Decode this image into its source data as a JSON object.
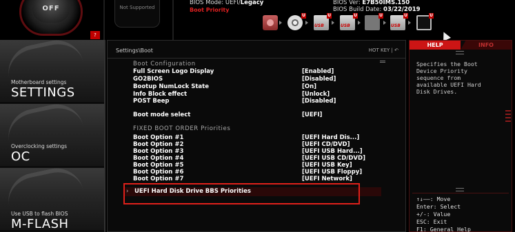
{
  "top": {
    "power_label": "OFF",
    "not_supported": "Not Supported",
    "bios_mode_prefix": "BIOS Mode: UEFI/",
    "bios_mode_value": "Legacy",
    "boot_priority": "Boot Priority",
    "bios_ver_prefix": "BIOS Ver: ",
    "bios_ver_value": "E7B50IMS.150",
    "bios_date_prefix": "BIOS Build Date: ",
    "bios_date_value": "03/22/2019",
    "badge": "?",
    "boot_devices": [
      {
        "icon": "hdd-icon"
      },
      {
        "icon": "cd-icon",
        "tag": "U"
      },
      {
        "icon": "usb-drive-icon",
        "label": "USB",
        "tag": "U"
      },
      {
        "icon": "usb-drive-icon",
        "label": "USB",
        "tag": "U"
      },
      {
        "icon": "usb-board-icon",
        "tag": "U"
      },
      {
        "icon": "usb-drive-icon",
        "label": "USB",
        "tag": "U"
      },
      {
        "icon": "network-icon",
        "tag": "U"
      }
    ]
  },
  "sidebar": {
    "items": [
      {
        "small": "Motherboard settings",
        "big": "SETTINGS"
      },
      {
        "small": "Overclocking settings",
        "big": "OC"
      },
      {
        "small": "Use USB to flash BIOS",
        "big": "M-FLASH"
      }
    ]
  },
  "main": {
    "breadcrumb": "Settings\\Boot",
    "hotkey": "HOT KEY  |  ↶",
    "boot_config_header": "Boot  Configuration",
    "config_rows": [
      {
        "label": "Full Screen Logo Display",
        "value": "[Enabled]"
      },
      {
        "label": "GO2BIOS",
        "value": "[Disabled]"
      },
      {
        "label": "Bootup NumLock State",
        "value": "[On]"
      },
      {
        "label": "Info Block effect",
        "value": "[Unlock]"
      },
      {
        "label": "POST Beep",
        "value": "[Disabled]"
      }
    ],
    "boot_mode": {
      "label": "Boot mode select",
      "value": "[UEFI]"
    },
    "fixed_header": "FIXED  BOOT  ORDER  Priorities",
    "boot_options": [
      {
        "label": "Boot Option #1",
        "value": "[UEFI Hard Dis...]"
      },
      {
        "label": "Boot Option #2",
        "value": "[UEFI CD/DVD]"
      },
      {
        "label": "Boot Option #3",
        "value": "[UEFI USB Hard...]"
      },
      {
        "label": "Boot Option #4",
        "value": "[UEFI USB CD/DVD]"
      },
      {
        "label": "Boot Option #5",
        "value": "[UEFI USB Key]"
      },
      {
        "label": "Boot Option #6",
        "value": "[UEFI USB Floppy]"
      },
      {
        "label": "Boot Option #7",
        "value": "[UEFI Network]"
      }
    ],
    "submenu": {
      "arrow": "›",
      "label": "UEFI Hard Disk Drive BBS Priorities"
    }
  },
  "help": {
    "tab_help": "HELP",
    "tab_info": "INFO",
    "text": "Specifies the Boot\nDevice Priority\nsequence from\navailable UEFI Hard\nDisk Drives.",
    "keys": "↑↓——: Move\nEnter: Select\n+/-: Value\nESC: Exit\nF1: General Help"
  },
  "colors": {
    "accent": "#cc1515",
    "background": "#0a0a0a",
    "highlight_border": "#e0201a"
  }
}
